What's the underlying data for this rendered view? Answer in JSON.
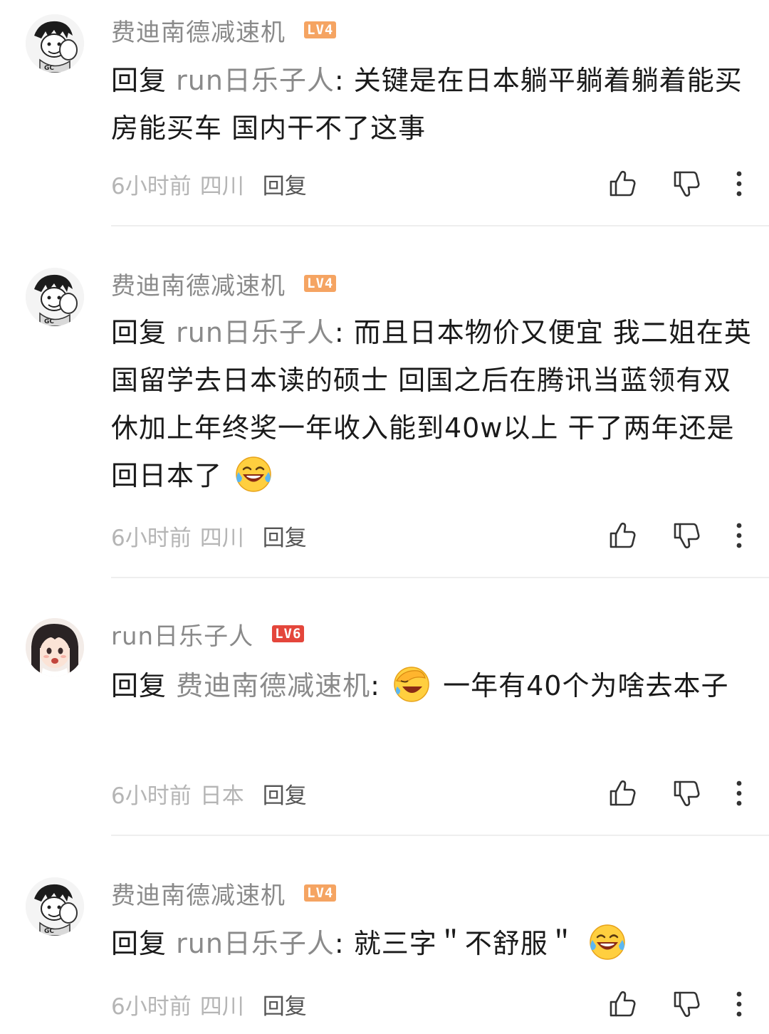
{
  "comments": [
    {
      "username": "费迪南德减速机",
      "level": "LV4",
      "reply_prefix": "回复",
      "reply_target": "run日乐子人",
      "text_before": "关键是在日本躺平躺着躺着能买房能买车 国内干不了这事",
      "emoji": "",
      "text_after": "",
      "time": "6小时前",
      "location": "四川",
      "reply_label": "回复"
    },
    {
      "username": "费迪南德减速机",
      "level": "LV4",
      "reply_prefix": "回复",
      "reply_target": "run日乐子人",
      "text_before": "而且日本物价又便宜 我二姐在英国留学去日本读的硕士 回国之后在腾讯当蓝领有双休加上年终奖一年收入能到40w以上 干了两年还是回日本了",
      "emoji": "laughing-crying-emoji",
      "text_after": "",
      "time": "6小时前",
      "location": "四川",
      "reply_label": "回复"
    },
    {
      "username": "run日乐子人",
      "level": "LV6",
      "reply_prefix": "回复",
      "reply_target": "费迪南德减速机",
      "text_before": "",
      "emoji": "facepalm-laugh-emoji",
      "text_after": "一年有40个为啥去本子",
      "time": "6小时前",
      "location": "日本",
      "reply_label": "回复"
    },
    {
      "username": "费迪南德减速机",
      "level": "LV4",
      "reply_prefix": "回复",
      "reply_target": "run日乐子人",
      "text_before": "就三字＂不舒服＂",
      "emoji": "laughing-crying-emoji",
      "text_after": "",
      "time": "6小时前",
      "location": "四川",
      "reply_label": "回复"
    }
  ],
  "icons": {
    "like": "thumbs-up-icon",
    "dislike": "thumbs-down-icon",
    "more": "more-vertical-icon"
  },
  "colors": {
    "level4": "#f5a462",
    "level6": "#e4463b",
    "muted_text": "#8a8a8a",
    "meta_text": "#b5b5b5"
  }
}
